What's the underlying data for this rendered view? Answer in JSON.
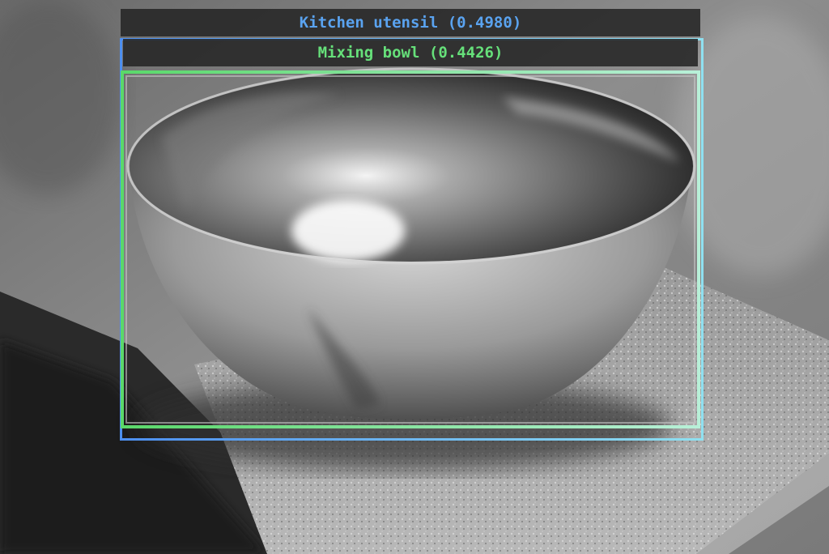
{
  "detections": [
    {
      "label": "Kitchen utensil (0.4980)",
      "color": "#5aa3f0"
    },
    {
      "label": "Mixing bowl (0.4426)",
      "color": "#66e07a"
    }
  ],
  "image": {
    "description_colors": {
      "background": "#8a8a8a",
      "bowl_metal": "#bdbdbd",
      "granite": "#9c9c9c"
    }
  }
}
